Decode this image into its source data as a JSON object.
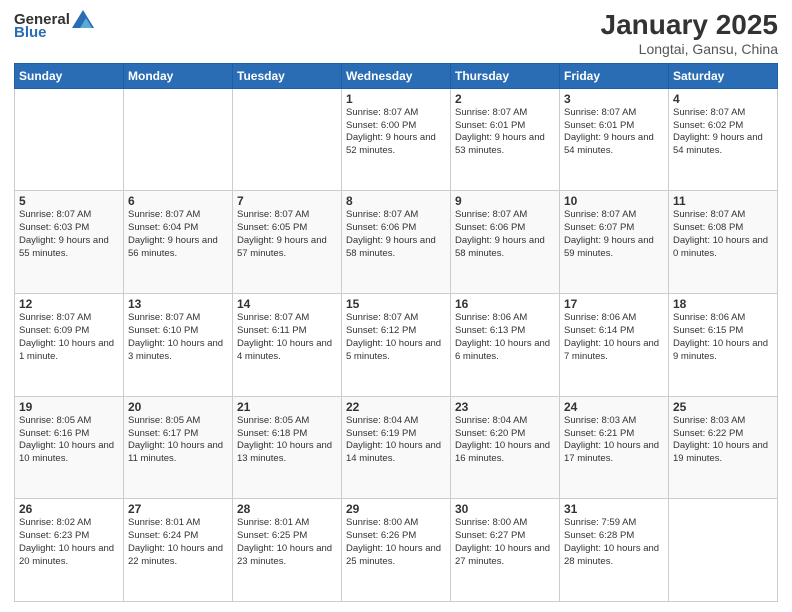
{
  "logo": {
    "general": "General",
    "blue": "Blue"
  },
  "header": {
    "title": "January 2025",
    "subtitle": "Longtai, Gansu, China"
  },
  "weekdays": [
    "Sunday",
    "Monday",
    "Tuesday",
    "Wednesday",
    "Thursday",
    "Friday",
    "Saturday"
  ],
  "weeks": [
    [
      {
        "day": "",
        "info": ""
      },
      {
        "day": "",
        "info": ""
      },
      {
        "day": "",
        "info": ""
      },
      {
        "day": "1",
        "info": "Sunrise: 8:07 AM\nSunset: 6:00 PM\nDaylight: 9 hours and 52 minutes."
      },
      {
        "day": "2",
        "info": "Sunrise: 8:07 AM\nSunset: 6:01 PM\nDaylight: 9 hours and 53 minutes."
      },
      {
        "day": "3",
        "info": "Sunrise: 8:07 AM\nSunset: 6:01 PM\nDaylight: 9 hours and 54 minutes."
      },
      {
        "day": "4",
        "info": "Sunrise: 8:07 AM\nSunset: 6:02 PM\nDaylight: 9 hours and 54 minutes."
      }
    ],
    [
      {
        "day": "5",
        "info": "Sunrise: 8:07 AM\nSunset: 6:03 PM\nDaylight: 9 hours and 55 minutes."
      },
      {
        "day": "6",
        "info": "Sunrise: 8:07 AM\nSunset: 6:04 PM\nDaylight: 9 hours and 56 minutes."
      },
      {
        "day": "7",
        "info": "Sunrise: 8:07 AM\nSunset: 6:05 PM\nDaylight: 9 hours and 57 minutes."
      },
      {
        "day": "8",
        "info": "Sunrise: 8:07 AM\nSunset: 6:06 PM\nDaylight: 9 hours and 58 minutes."
      },
      {
        "day": "9",
        "info": "Sunrise: 8:07 AM\nSunset: 6:06 PM\nDaylight: 9 hours and 58 minutes."
      },
      {
        "day": "10",
        "info": "Sunrise: 8:07 AM\nSunset: 6:07 PM\nDaylight: 9 hours and 59 minutes."
      },
      {
        "day": "11",
        "info": "Sunrise: 8:07 AM\nSunset: 6:08 PM\nDaylight: 10 hours and 0 minutes."
      }
    ],
    [
      {
        "day": "12",
        "info": "Sunrise: 8:07 AM\nSunset: 6:09 PM\nDaylight: 10 hours and 1 minute."
      },
      {
        "day": "13",
        "info": "Sunrise: 8:07 AM\nSunset: 6:10 PM\nDaylight: 10 hours and 3 minutes."
      },
      {
        "day": "14",
        "info": "Sunrise: 8:07 AM\nSunset: 6:11 PM\nDaylight: 10 hours and 4 minutes."
      },
      {
        "day": "15",
        "info": "Sunrise: 8:07 AM\nSunset: 6:12 PM\nDaylight: 10 hours and 5 minutes."
      },
      {
        "day": "16",
        "info": "Sunrise: 8:06 AM\nSunset: 6:13 PM\nDaylight: 10 hours and 6 minutes."
      },
      {
        "day": "17",
        "info": "Sunrise: 8:06 AM\nSunset: 6:14 PM\nDaylight: 10 hours and 7 minutes."
      },
      {
        "day": "18",
        "info": "Sunrise: 8:06 AM\nSunset: 6:15 PM\nDaylight: 10 hours and 9 minutes."
      }
    ],
    [
      {
        "day": "19",
        "info": "Sunrise: 8:05 AM\nSunset: 6:16 PM\nDaylight: 10 hours and 10 minutes."
      },
      {
        "day": "20",
        "info": "Sunrise: 8:05 AM\nSunset: 6:17 PM\nDaylight: 10 hours and 11 minutes."
      },
      {
        "day": "21",
        "info": "Sunrise: 8:05 AM\nSunset: 6:18 PM\nDaylight: 10 hours and 13 minutes."
      },
      {
        "day": "22",
        "info": "Sunrise: 8:04 AM\nSunset: 6:19 PM\nDaylight: 10 hours and 14 minutes."
      },
      {
        "day": "23",
        "info": "Sunrise: 8:04 AM\nSunset: 6:20 PM\nDaylight: 10 hours and 16 minutes."
      },
      {
        "day": "24",
        "info": "Sunrise: 8:03 AM\nSunset: 6:21 PM\nDaylight: 10 hours and 17 minutes."
      },
      {
        "day": "25",
        "info": "Sunrise: 8:03 AM\nSunset: 6:22 PM\nDaylight: 10 hours and 19 minutes."
      }
    ],
    [
      {
        "day": "26",
        "info": "Sunrise: 8:02 AM\nSunset: 6:23 PM\nDaylight: 10 hours and 20 minutes."
      },
      {
        "day": "27",
        "info": "Sunrise: 8:01 AM\nSunset: 6:24 PM\nDaylight: 10 hours and 22 minutes."
      },
      {
        "day": "28",
        "info": "Sunrise: 8:01 AM\nSunset: 6:25 PM\nDaylight: 10 hours and 23 minutes."
      },
      {
        "day": "29",
        "info": "Sunrise: 8:00 AM\nSunset: 6:26 PM\nDaylight: 10 hours and 25 minutes."
      },
      {
        "day": "30",
        "info": "Sunrise: 8:00 AM\nSunset: 6:27 PM\nDaylight: 10 hours and 27 minutes."
      },
      {
        "day": "31",
        "info": "Sunrise: 7:59 AM\nSunset: 6:28 PM\nDaylight: 10 hours and 28 minutes."
      },
      {
        "day": "",
        "info": ""
      }
    ]
  ]
}
